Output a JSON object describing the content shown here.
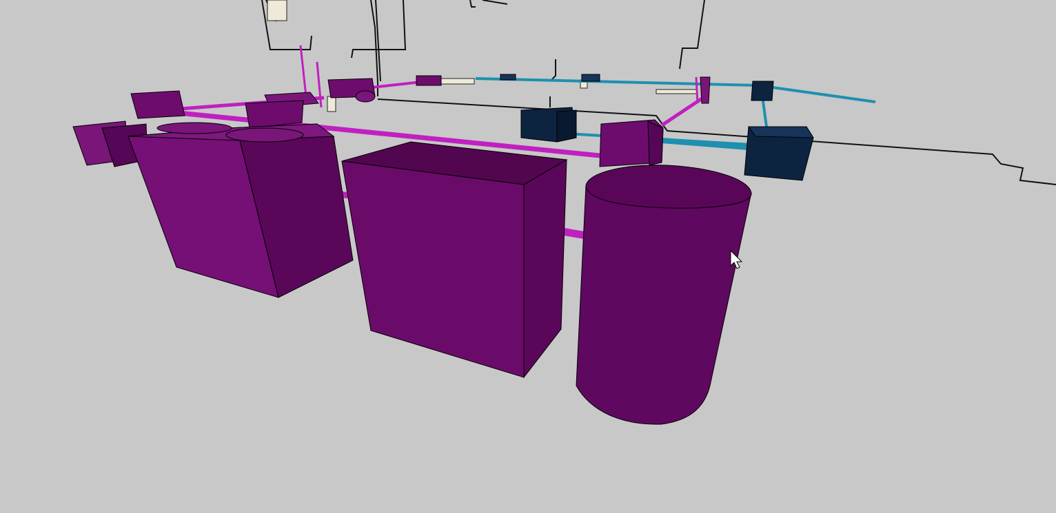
{
  "viewport": {
    "background": "#c8c8c8",
    "colors": {
      "purple_front": "#6e0c6e",
      "purple_side": "#560656",
      "purple_top": "#7a157a",
      "pipe_magenta": "#c020c0",
      "pipe_cyan": "#1e8fb0",
      "navy_box": "#0d2440",
      "outline": "#000000"
    },
    "cursor": {
      "icon": "mouse-pointer-icon"
    }
  }
}
